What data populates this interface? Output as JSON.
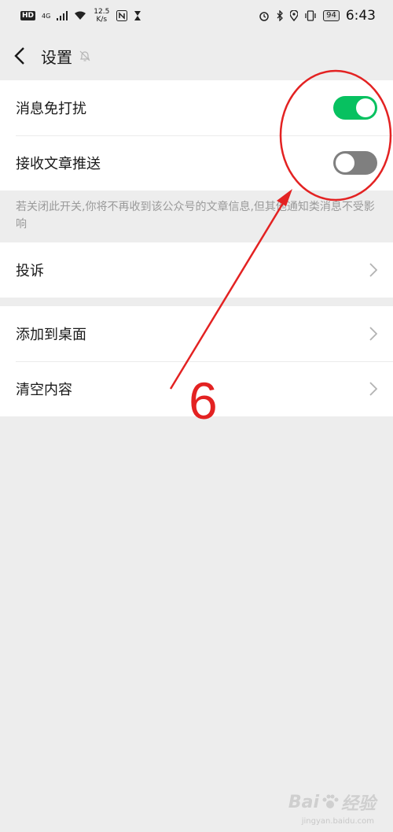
{
  "statusbar": {
    "hd": "HD",
    "network": "4G",
    "speed_value": "12.5",
    "speed_unit": "K/s",
    "battery": "94",
    "time": "6:43",
    "icons": [
      "signal-icon",
      "wifi-icon",
      "nfc-icon",
      "hourglass-icon",
      "alarm-icon",
      "bluetooth-icon",
      "location-icon",
      "vibrate-icon"
    ]
  },
  "header": {
    "title": "设置",
    "back_icon": "chevron-left-icon",
    "mute_icon": "bell-off-icon"
  },
  "settings": {
    "dnd_label": "消息免打扰",
    "dnd_enabled": true,
    "push_label": "接收文章推送",
    "push_enabled": false,
    "push_note": "若关闭此开关,你将不再收到该公众号的文章信息,但其他通知类消息不受影响",
    "complain_label": "投诉",
    "add_desktop_label": "添加到桌面",
    "clear_label": "清空内容"
  },
  "colors": {
    "toggle_on": "#07c160",
    "toggle_off": "#7f7f7f",
    "annotation": "#e32222"
  },
  "annotation": {
    "step_number": "6"
  },
  "watermark": {
    "brand": "Bai",
    "brand_end": "经验",
    "sub": "jingyan.baidu.com"
  }
}
